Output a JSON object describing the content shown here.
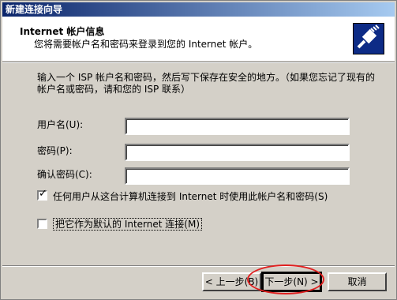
{
  "window": {
    "title": "新建连接向导"
  },
  "header": {
    "title": "Internet 帐户信息",
    "subtitle": "您将需要帐户名和密码来登录到您的 Internet 帐户。"
  },
  "intro_text": "输入一个 ISP 帐户名和密码，然后写下保存在安全的地方。（如果您忘记了现有的帐户名或密码，请和您的 ISP 联系）",
  "form": {
    "username_label": "用户名(U):",
    "username_value": "",
    "password_label": "密码(P):",
    "password_value": "",
    "confirm_label": "确认密码(C):",
    "confirm_value": "",
    "checkbox_all_users": {
      "label": "任何用户从这台计算机连接到 Internet 时使用此帐户名和密码(S)",
      "checked": true
    },
    "checkbox_default": {
      "label": "把它作为默认的 Internet 连接(M)",
      "checked": false
    }
  },
  "buttons": {
    "back": "< 上一步(B)",
    "next": "下一步(N) >",
    "cancel": "取消"
  },
  "icons": {
    "header_icon": "network-cable-icon"
  },
  "colors": {
    "title_start": "#0a246a",
    "title_end": "#a6caf0",
    "highlight_oval": "#e02020"
  }
}
